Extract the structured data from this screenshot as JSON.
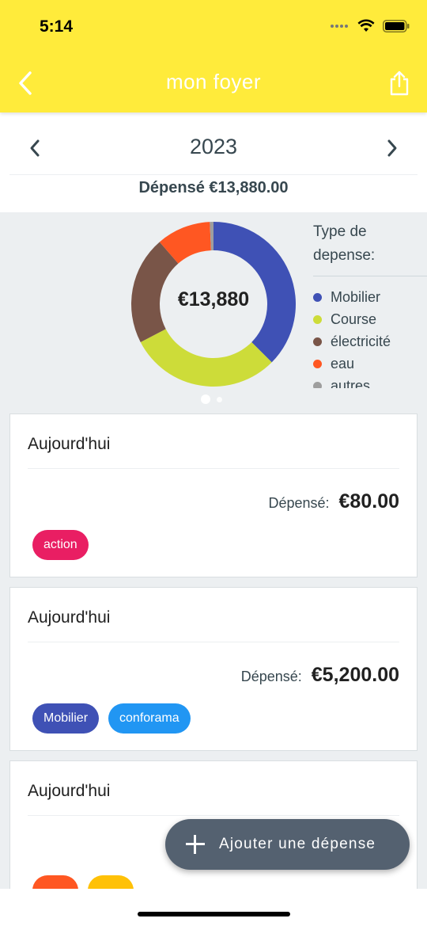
{
  "status_bar": {
    "time": "5:14"
  },
  "header": {
    "title": "mon foyer",
    "back_icon": "chevron-left-icon",
    "share_icon": "share-icon",
    "background": "#ffeb3b"
  },
  "year_selector": {
    "year": "2023",
    "total_label": "Dépensé €13,880.00"
  },
  "chart_data": {
    "type": "pie",
    "center_label": "€13,880",
    "legend_title": "Type de depense:",
    "categories": [
      "Mobilier",
      "Course",
      "électricité",
      "eau",
      "autres"
    ],
    "values": [
      5200,
      4150,
      2950,
      1480,
      100
    ],
    "colors": [
      "#3f51b5",
      "#cddc39",
      "#795548",
      "#ff5722",
      "#9e9e9e"
    ],
    "legend_position": "right"
  },
  "pager": {
    "pages": 2,
    "active": 0
  },
  "cards": [
    {
      "date": "Aujourd'hui",
      "amount_label": "Dépensé:",
      "amount": "€80.00",
      "tags": [
        {
          "label": "action",
          "color": "#e91e63"
        }
      ]
    },
    {
      "date": "Aujourd'hui",
      "amount_label": "Dépensé:",
      "amount": "€5,200.00",
      "tags": [
        {
          "label": "Mobilier",
          "color": "#3f51b5"
        },
        {
          "label": "conforama",
          "color": "#2196f3"
        }
      ]
    },
    {
      "date": "Aujourd'hui",
      "amount_label": "",
      "amount": "",
      "tags": [
        {
          "label": "",
          "color": "#ff5722"
        },
        {
          "label": "",
          "color": "#ffc107"
        }
      ]
    }
  ],
  "fab": {
    "label": "Ajouter une dépense",
    "icon": "plus-icon"
  }
}
